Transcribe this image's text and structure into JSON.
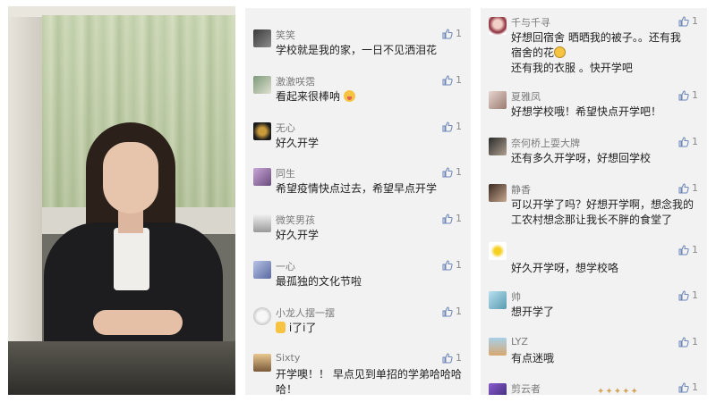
{
  "left_panel": {
    "comments": [
      {
        "user": "笑笑",
        "text": "学校就是我的家，一日不见洒泪花",
        "likes": "1"
      },
      {
        "user": "激激咲霑",
        "text": "看起来很棒呐",
        "emoji": "tongue",
        "likes": "1"
      },
      {
        "user": "无心",
        "text": "好久开学",
        "likes": "1"
      },
      {
        "user": "同生",
        "text": "希望疫情快点过去，希望早点开学",
        "likes": "1"
      },
      {
        "user": "微笑男孩",
        "text": "好久开学",
        "likes": "1"
      },
      {
        "user": "一心",
        "text": "最孤独的文化节啦",
        "likes": "1"
      },
      {
        "user": "小龙人摆一摆",
        "text": "i了i了",
        "emoji_prefix": "thumbs",
        "likes": "1"
      },
      {
        "user": "Sixty",
        "text": "开学噢！！ 早点见到单招的学弟哈哈哈哈！",
        "likes": "1"
      }
    ]
  },
  "right_panel": {
    "comments": [
      {
        "user": "千与千寻",
        "text_line1": "好想回宿舍 晒晒我的被子。。还有我",
        "text_line2": "宿舍的花",
        "emoji": "sad",
        "text_line3": "还有我的衣服 。快开学吧",
        "likes": "1"
      },
      {
        "user": "夏雅凤",
        "text": "好想学校哦！希望快点开学吧！",
        "likes": "1"
      },
      {
        "user": "奈何桥上耍大牌",
        "text": "还有多久开学呀，好想回学校",
        "likes": "1"
      },
      {
        "user": "静香",
        "text": "可以开学了吗？好想开学啊，想念我的工农村想念那让我长不胖的食堂了",
        "likes": "1"
      },
      {
        "user": "",
        "text": "好久开学呀，想学校咯",
        "likes": "1"
      },
      {
        "user": "帅",
        "text": "想开学了",
        "likes": "1"
      },
      {
        "user": "LYZ",
        "text": "有点迷哦",
        "likes": "1"
      },
      {
        "user": "剪云者",
        "text": "",
        "likes": "1"
      }
    ]
  },
  "icons": {
    "like": "thumbs-up-icon"
  },
  "colors": {
    "panel_bg": "#f2f2f2",
    "username": "#7a7a7a",
    "text": "#1f1f1f"
  }
}
